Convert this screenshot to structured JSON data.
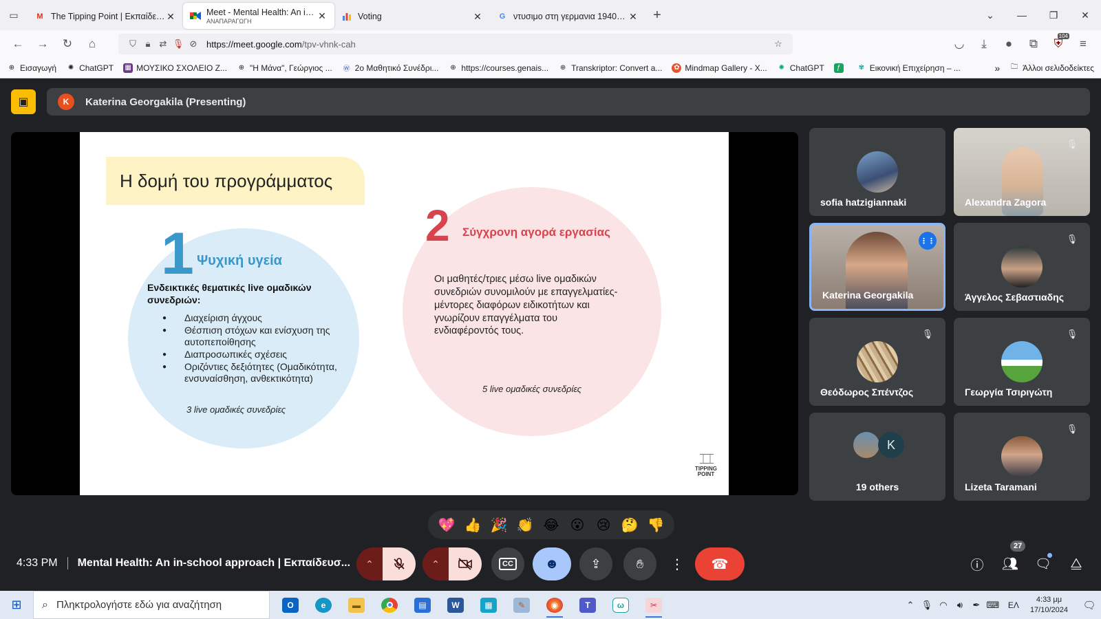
{
  "browser": {
    "tabs": [
      {
        "label": "The Tipping Point | Εκπαίδευση",
        "icon": "gmail-icon",
        "sub": "",
        "active": false
      },
      {
        "label": "Meet - Mental Health: An in-sc",
        "icon": "meet-icon",
        "sub": "ΑΝΑΠΑΡΑΓΩΓΗ",
        "active": true
      },
      {
        "label": "Voting",
        "icon": "forms-icon",
        "sub": "",
        "active": false
      },
      {
        "label": "ντυσιμο στη γερμανια 1940 - A",
        "icon": "google-icon",
        "sub": "",
        "active": false
      }
    ],
    "url_host": "https://meet.google.com",
    "url_path": "/tpv-vhnk-cah",
    "extension_badge": "104",
    "bookmarks": [
      "Εισαγωγή",
      "ChatGPT",
      "ΜΟΥΣΙΚΟ ΣΧΟΛΕΙΟ Ζ...",
      "\"Η Μάνα\", Γεώργιος ...",
      "2ο Μαθητικό Συνέδρι...",
      "https://courses.genais...",
      "Transkriptor: Convert a...",
      "Mindmap Gallery - X...",
      "ChatGPT",
      "",
      "Εικονική Επιχείρηση – ..."
    ],
    "other_bookmarks": "Άλλοι σελιδοδείκτες"
  },
  "meet": {
    "presenter_initial": "K",
    "presenter_label": "Katerina Georgakila (Presenting)",
    "slide": {
      "title": "Η δομή του προγράμματος",
      "section1_num": "1",
      "section1_title": "Ψυχική υγεία",
      "section1_sub": "Ενδεικτικές θεματικές live ομαδικών συνεδριών:",
      "section1_items": [
        "Διαχείριση άγχους",
        "Θέσπιση στόχων και ενίσχυση της αυτοπεποίθησης",
        "Διαπροσωπικές σχέσεις",
        "Οριζόντιες δεξιότητες (Ομαδικότητα, ενσυναίσθηση, ανθεκτικότητα)"
      ],
      "section1_foot": "3 live ομαδικές συνεδρίες",
      "section2_num": "2",
      "section2_title": "Σύγχρονη αγορά εργασίας",
      "section2_text": "Οι μαθητές/τριες μέσω live ομαδικών συνεδριών συνομιλούν με επαγγελματίες- μέντορες διαφόρων ειδικοτήτων και γνωρίζουν επαγγέλματα του ενδιαφέροντός τους.",
      "section2_foot": "5 live ομαδικές συνεδρίες",
      "logo_text": "TIPPING POINT"
    },
    "participants": [
      {
        "name": "sofia hatzigiannaki",
        "muted": false
      },
      {
        "name": "Alexandra Zagora",
        "muted": true
      },
      {
        "name": "Katerina Georgakila",
        "muted": false,
        "speaking": true
      },
      {
        "name": "Άγγελος Σεβαστιαδης",
        "muted": true
      },
      {
        "name": "Θεόδωρος Σπέντζος",
        "muted": true
      },
      {
        "name": "Γεωργία Τσιριγώτη",
        "muted": true
      },
      {
        "name": "19 others",
        "muted": false,
        "extra_initial": "K"
      },
      {
        "name": "Lizeta Taramani",
        "muted": true
      }
    ],
    "reactions": [
      "💖",
      "👍",
      "🎉",
      "👏",
      "😂",
      "😮",
      "😢",
      "🤔",
      "👎"
    ],
    "time": "4:33 PM",
    "meeting_title": "Mental Health: An in-school approach | Εκπαίδευσ...",
    "people_count": "27"
  },
  "taskbar": {
    "search_placeholder": "Πληκτρολογήστε εδώ για αναζήτηση",
    "language": "ΕΛ",
    "time": "4:33 μμ",
    "date": "17/10/2024"
  },
  "colors": {
    "meet_bg": "#202124",
    "tile_bg": "#3c4043",
    "end_call": "#ea4335",
    "slide_blue": "#3a97c9",
    "slide_red": "#d8434d"
  }
}
